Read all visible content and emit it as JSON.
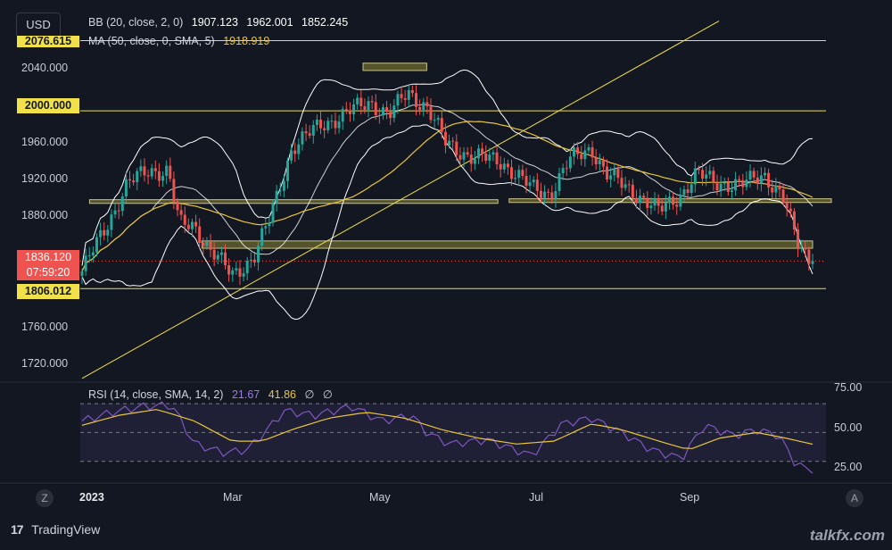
{
  "toolbar": {
    "currency": "USD",
    "z_button": "Z",
    "a_button": "A"
  },
  "legend": {
    "bb": {
      "label": "BB (20, close, 2, 0)",
      "basis": "1907.123",
      "upper": "1962.001",
      "lower": "1852.245"
    },
    "ma": {
      "label": "MA (50, close, 0, SMA, 5)",
      "value": "1918.919"
    },
    "rsi": {
      "label": "RSI (14, close, SMA, 14, 2)",
      "value": "21.67",
      "ma": "41.86",
      "extra1": "∅",
      "extra2": "∅"
    }
  },
  "price_axis": {
    "ticks": [
      "2040.000",
      "2000.000",
      "1960.000",
      "1920.000",
      "1880.000",
      "1760.000",
      "1720.000"
    ],
    "top_label": "2076.615",
    "label_2000": "2000.000",
    "current_price": "1836.120",
    "countdown": "07:59:20",
    "label_1806": "1806.012"
  },
  "rsi_axis": {
    "ticks": [
      "75.00",
      "50.00",
      "25.00"
    ]
  },
  "time_axis": {
    "labels": [
      "2023",
      "Mar",
      "May",
      "Jul",
      "Sep"
    ]
  },
  "footer": {
    "brand": "TradingView",
    "logo": "17",
    "watermark": "talkfx.com"
  },
  "colors": {
    "bg": "#131722",
    "up": "#26a69a",
    "down": "#ef5350",
    "ma": "#e8c53a",
    "bb": "#ffffff",
    "rsi": "#7e57c2",
    "rsi_ma": "#e8c53a",
    "level": "#f0e04a",
    "zone": "#6b6830"
  },
  "chart_data": {
    "type": "candlestick",
    "instrument_currency": "USD",
    "price_range": [
      1700,
      2080
    ],
    "horizontal_levels": [
      2076.615,
      2000,
      1806.012
    ],
    "zones": [
      {
        "from_month": 3.75,
        "to_month": 4.6,
        "low": 2044,
        "high": 2052
      },
      {
        "from_month": 0.1,
        "to_month": 5.55,
        "low": 1899,
        "high": 1903
      },
      {
        "from_month": 5.7,
        "to_month": 10.0,
        "low": 1900,
        "high": 1904
      },
      {
        "from_month": 1.6,
        "to_month": 9.75,
        "low": 1850,
        "high": 1858
      }
    ],
    "trendline": {
      "from": [
        0.0,
        1708
      ],
      "to": [
        8.5,
        2098
      ]
    },
    "close_series_monthly": [
      [
        0.0,
        1825
      ],
      [
        0.3,
        1870
      ],
      [
        0.6,
        1920
      ],
      [
        0.9,
        1935
      ],
      [
        1.15,
        1935
      ],
      [
        1.3,
        1875
      ],
      [
        1.5,
        1875
      ],
      [
        1.7,
        1850
      ],
      [
        2.0,
        1820
      ],
      [
        2.3,
        1842
      ],
      [
        2.5,
        1880
      ],
      [
        2.8,
        1960
      ],
      [
        3.2,
        1985
      ],
      [
        3.6,
        2000
      ],
      [
        3.85,
        2010
      ],
      [
        4.1,
        1995
      ],
      [
        4.35,
        2020
      ],
      [
        4.6,
        2005
      ],
      [
        4.85,
        1965
      ],
      [
        5.2,
        1950
      ],
      [
        5.6,
        1945
      ],
      [
        6.0,
        1915
      ],
      [
        6.25,
        1910
      ],
      [
        6.5,
        1945
      ],
      [
        6.8,
        1960
      ],
      [
        7.0,
        1930
      ],
      [
        7.4,
        1910
      ],
      [
        7.7,
        1890
      ],
      [
        8.0,
        1910
      ],
      [
        8.2,
        1930
      ],
      [
        8.5,
        1922
      ],
      [
        8.8,
        1918
      ],
      [
        9.1,
        1932
      ],
      [
        9.35,
        1905
      ],
      [
        9.55,
        1855
      ],
      [
        9.75,
        1836
      ]
    ],
    "rsi": {
      "levels": [
        70,
        50,
        30
      ],
      "range": [
        20,
        78
      ],
      "series": [
        [
          0.0,
          58
        ],
        [
          0.4,
          64
        ],
        [
          0.8,
          68
        ],
        [
          1.2,
          69
        ],
        [
          1.5,
          42
        ],
        [
          1.9,
          36
        ],
        [
          2.2,
          38
        ],
        [
          2.4,
          48
        ],
        [
          2.7,
          65
        ],
        [
          3.1,
          62
        ],
        [
          3.6,
          68
        ],
        [
          4.0,
          58
        ],
        [
          4.4,
          62
        ],
        [
          4.6,
          50
        ],
        [
          4.9,
          42
        ],
        [
          5.4,
          45
        ],
        [
          6.0,
          34
        ],
        [
          6.4,
          56
        ],
        [
          6.8,
          60
        ],
        [
          7.2,
          50
        ],
        [
          7.6,
          38
        ],
        [
          8.0,
          32
        ],
        [
          8.3,
          55
        ],
        [
          8.7,
          48
        ],
        [
          9.0,
          52
        ],
        [
          9.3,
          48
        ],
        [
          9.5,
          30
        ],
        [
          9.75,
          21.67
        ]
      ],
      "ma_series": [
        [
          0.0,
          55
        ],
        [
          0.5,
          62
        ],
        [
          1.0,
          66
        ],
        [
          1.5,
          58
        ],
        [
          2.0,
          44
        ],
        [
          2.4,
          44
        ],
        [
          2.8,
          52
        ],
        [
          3.3,
          60
        ],
        [
          3.8,
          64
        ],
        [
          4.3,
          60
        ],
        [
          4.8,
          52
        ],
        [
          5.3,
          46
        ],
        [
          5.8,
          42
        ],
        [
          6.3,
          44
        ],
        [
          6.8,
          56
        ],
        [
          7.2,
          52
        ],
        [
          7.7,
          44
        ],
        [
          8.1,
          38
        ],
        [
          8.5,
          46
        ],
        [
          9.0,
          50
        ],
        [
          9.4,
          46
        ],
        [
          9.75,
          41.86
        ]
      ]
    },
    "moving_average": {
      "type": "SMA",
      "length": 50,
      "last": 1918.919
    },
    "bollinger": {
      "length": 20,
      "basis": 1907.123,
      "upper": 1962.001,
      "lower": 1852.245
    }
  }
}
